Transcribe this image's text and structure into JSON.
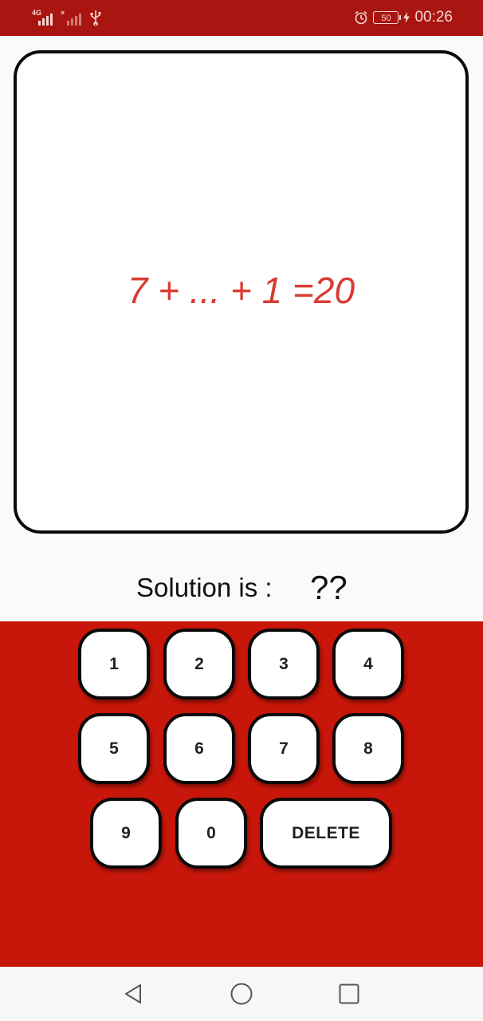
{
  "status_bar": {
    "signal1_tag": "4G",
    "signal2_tag": "×",
    "battery": "50",
    "time": "00:26"
  },
  "question": {
    "equation": "7 + ... + 1 =20"
  },
  "solution": {
    "label": "Solution is :",
    "value": "??"
  },
  "keypad": {
    "row1": [
      "1",
      "2",
      "3",
      "4"
    ],
    "row2": [
      "5",
      "6",
      "7",
      "8"
    ],
    "row3": [
      "9",
      "0",
      "DELETE"
    ]
  },
  "colors": {
    "status_bar": "#a91510",
    "keypad_background": "#c8160a",
    "equation_text": "#d93b34"
  },
  "icons": [
    "signal-4g-icon",
    "signal-no-sim-icon",
    "usb-icon",
    "alarm-icon",
    "battery-icon",
    "charging-icon",
    "nav-back-icon",
    "nav-home-icon",
    "nav-recents-icon"
  ]
}
